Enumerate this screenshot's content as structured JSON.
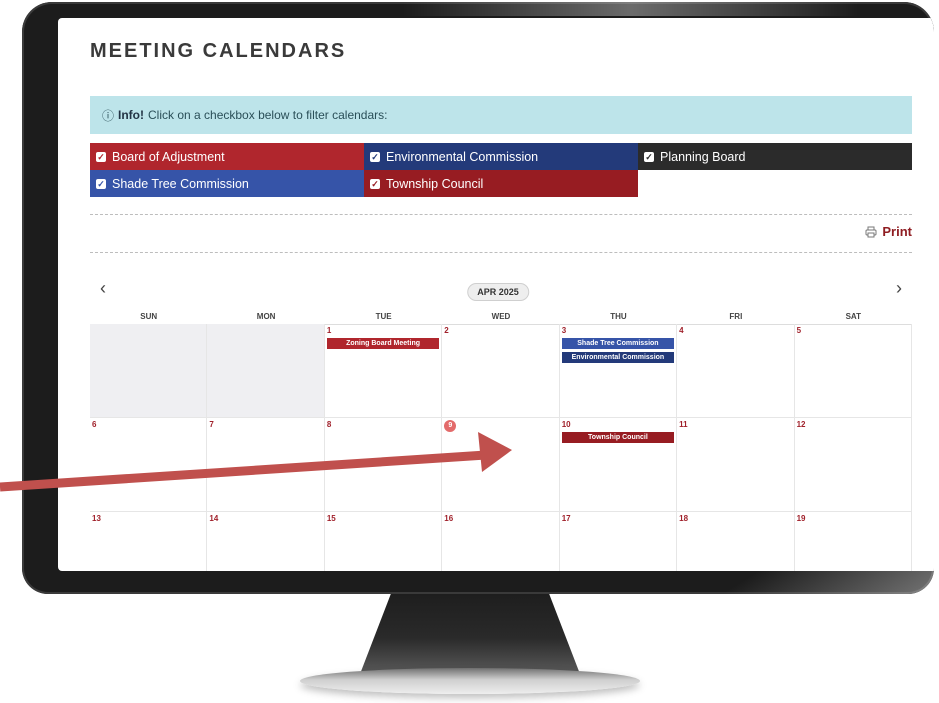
{
  "page": {
    "title": "MEETING CALENDARS"
  },
  "info": {
    "icon": "info-circle-icon",
    "label": "Info!",
    "text": "Click on a checkbox below to filter calendars:"
  },
  "filters": [
    {
      "label": "Board of Adjustment",
      "color": "#b0262d",
      "checked": true
    },
    {
      "label": "Environmental Commission",
      "color": "#233a7a",
      "checked": true
    },
    {
      "label": "Planning Board",
      "color": "#2b2b2b",
      "checked": true
    },
    {
      "label": "Shade Tree Commission",
      "color": "#3654a8",
      "checked": true
    },
    {
      "label": "Township Council",
      "color": "#971c22",
      "checked": true
    }
  ],
  "print": {
    "label": "Print",
    "icon": "printer-icon"
  },
  "calendar": {
    "month_label": "APR 2025",
    "prev_icon": "chevron-left-icon",
    "next_icon": "chevron-right-icon",
    "weekdays": [
      "SUN",
      "MON",
      "TUE",
      "WED",
      "THU",
      "FRI",
      "SAT"
    ],
    "today": "9",
    "weeks": [
      [
        {
          "day": "",
          "events": []
        },
        {
          "day": "",
          "events": []
        },
        {
          "day": "1",
          "events": [
            {
              "title": "Zoning Board Meeting",
              "color": "#b0262d"
            }
          ]
        },
        {
          "day": "2",
          "events": []
        },
        {
          "day": "3",
          "events": [
            {
              "title": "Shade Tree Commission",
              "color": "#3654a8"
            },
            {
              "title": "Environmental Commission",
              "color": "#233a7a"
            }
          ]
        },
        {
          "day": "4",
          "events": []
        },
        {
          "day": "5",
          "events": []
        }
      ],
      [
        {
          "day": "6",
          "events": []
        },
        {
          "day": "7",
          "events": []
        },
        {
          "day": "8",
          "events": []
        },
        {
          "day": "9",
          "events": []
        },
        {
          "day": "10",
          "events": [
            {
              "title": "Township Council",
              "color": "#971c22"
            }
          ]
        },
        {
          "day": "11",
          "events": []
        },
        {
          "day": "12",
          "events": []
        }
      ],
      [
        {
          "day": "13",
          "events": []
        },
        {
          "day": "14",
          "events": []
        },
        {
          "day": "15",
          "events": []
        },
        {
          "day": "16",
          "events": []
        },
        {
          "day": "17",
          "events": []
        },
        {
          "day": "18",
          "events": []
        },
        {
          "day": "19",
          "events": []
        }
      ]
    ]
  },
  "annotation": {
    "icon": "pointer-arrow-icon",
    "color": "#c0504d"
  },
  "monitor": {
    "bezel_color": "#1c1c1c"
  }
}
